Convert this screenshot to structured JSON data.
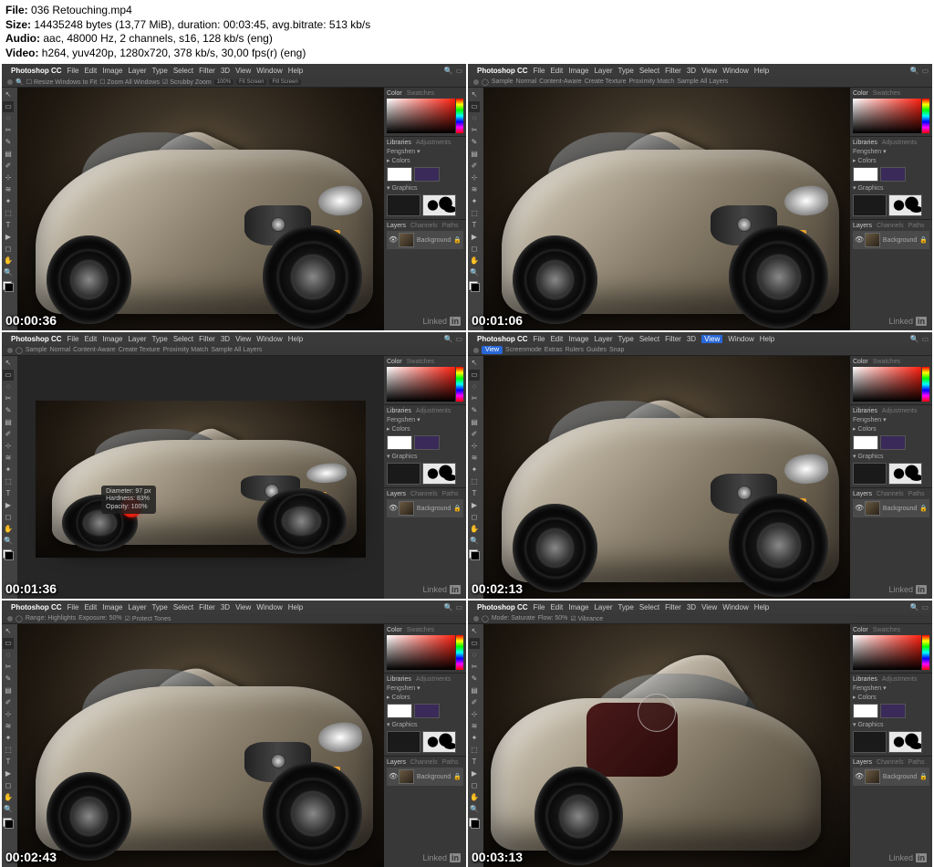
{
  "metadata": {
    "file_label": "File:",
    "file_value": "036 Retouching.mp4",
    "size_label": "Size:",
    "size_value": "14435248 bytes (13,77 MiB), duration: 00:03:45, avg.bitrate: 513 kb/s",
    "audio_label": "Audio:",
    "audio_value": "aac, 48000 Hz, 2 channels, s16, 128 kb/s (eng)",
    "video_label": "Video:",
    "video_value": "h264, yuv420p, 1280x720, 378 kb/s, 30,00 fps(r) (eng)"
  },
  "app": {
    "name": "Photoshop CC",
    "menus": [
      "File",
      "Edit",
      "Image",
      "Layer",
      "Type",
      "Select",
      "Filter",
      "3D",
      "View",
      "Window",
      "Help"
    ]
  },
  "optionbar": {
    "resize": "Resize Windows to Fit",
    "zoomall": "Zoom All Windows",
    "scrubby": "Scrubby Zoom",
    "pct": "100%",
    "fit": "Fit Screen",
    "fill": "Fill Screen",
    "sample": "Sample",
    "normal": "Normal",
    "contentaware": "Content-Aware",
    "createtexture": "Create Texture",
    "proximity": "Proximity Match",
    "samplealllayers": "Sample All Layers",
    "range": "Range:",
    "highlights": "Highlights",
    "exposure": "Exposure:",
    "exposureval": "50%",
    "protect": "Protect Tones",
    "viewlabel": "View:",
    "screenmode": "Screenmode",
    "extras": "Extras",
    "rulers": "Rulers",
    "guides": "Guides",
    "snap": "Snap",
    "mode": "Mode:",
    "saturate": "Saturate",
    "flow": "Flow:",
    "vibrance": "Vibrance"
  },
  "panels": {
    "color": "Color",
    "swatches": "Swatches",
    "libraries": "Libraries",
    "adjustments": "Adjustments",
    "libname": "Fengshen",
    "colors": "▸ Colors",
    "graphics": "▾ Graphics",
    "layers": "Layers",
    "channels": "Channels",
    "paths": "Paths",
    "bglayer": "Background",
    "swatch1": "#ffffff",
    "swatch2": "#3a2a5a"
  },
  "hud": {
    "diameter_label": "Diameter:",
    "diameter_val": "97 px",
    "hardness_label": "Hardness:",
    "hardness_val": "83%",
    "opacity_label": "Opacity:",
    "opacity_val": "100%"
  },
  "timestamps": [
    "00:00:36",
    "00:01:06",
    "00:01:36",
    "00:02:13",
    "00:02:43",
    "00:03:13"
  ],
  "watermark": {
    "text": "Linked",
    "suffix": "in"
  },
  "frames": [
    {
      "optmode": "zoom",
      "canvas": "fill",
      "car": "front"
    },
    {
      "optmode": "heal",
      "canvas": "fill",
      "car": "front"
    },
    {
      "optmode": "heal",
      "canvas": "padded",
      "car": "front",
      "brush": true
    },
    {
      "optmode": "view",
      "canvas": "fill",
      "car": "front"
    },
    {
      "optmode": "dodge",
      "canvas": "fill",
      "car": "front"
    },
    {
      "optmode": "sponge",
      "canvas": "fill",
      "car": "door",
      "loupe": true
    }
  ]
}
